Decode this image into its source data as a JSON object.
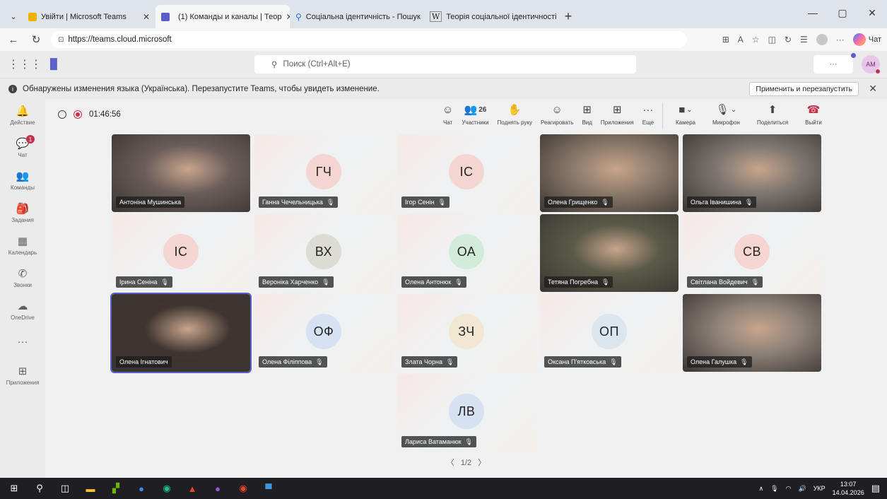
{
  "browser": {
    "tabs": [
      {
        "title": "Увійти | Microsoft Teams",
        "color": "#f0b400"
      },
      {
        "title": "(1) Команды и каналы | Теор",
        "color": "#5b5fc7"
      },
      {
        "title": "Соціальна ідентичність - Пошук",
        "color": "#1e72d8"
      },
      {
        "title": "Теорія соціальної ідентичності —",
        "color": "#444444"
      }
    ],
    "url": "https://teams.cloud.microsoft",
    "chat_label": "Чат"
  },
  "header": {
    "search_placeholder": "Поиск (Ctrl+Alt+E)",
    "more": "···",
    "avatar": "AM"
  },
  "banner": {
    "text": "Обнаружены изменения языка (Українська). Перезапустите Teams, чтобы увидеть изменение.",
    "apply": "Применить и перезапустить"
  },
  "rail": [
    {
      "label": "Действие",
      "icon": "bell-icon",
      "glyph": "🔔"
    },
    {
      "label": "Чат",
      "icon": "chat-icon",
      "glyph": "💬",
      "badge": "1"
    },
    {
      "label": "Команды",
      "icon": "teams-icon",
      "glyph": "👥"
    },
    {
      "label": "Задания",
      "icon": "assignments-icon",
      "glyph": "🎒"
    },
    {
      "label": "Календарь",
      "icon": "calendar-icon",
      "glyph": "▦"
    },
    {
      "label": "Звонки",
      "icon": "phone-icon",
      "glyph": "✆"
    },
    {
      "label": "OneDrive",
      "icon": "onedrive-icon",
      "glyph": "☁"
    },
    {
      "label": "",
      "icon": "more-icon",
      "glyph": "···"
    },
    {
      "label": "Приложения",
      "icon": "apps-icon",
      "glyph": "⊞"
    }
  ],
  "meeting": {
    "timer": "01:46:56",
    "participants_count": "26",
    "tools": [
      {
        "label": "Чат",
        "icon": "chat-icon",
        "glyph": "☺"
      },
      {
        "label": "Участники",
        "icon": "people-icon",
        "glyph": "👥"
      },
      {
        "label": "Поднять руку",
        "icon": "raise-hand-icon",
        "glyph": "✋"
      },
      {
        "label": "Реагировать",
        "icon": "react-icon",
        "glyph": "☺"
      },
      {
        "label": "Вид",
        "icon": "view-icon",
        "glyph": "⊞"
      },
      {
        "label": "Приложения",
        "icon": "apps-icon",
        "glyph": "⊞"
      },
      {
        "label": "Еще",
        "icon": "more-icon",
        "glyph": "···"
      }
    ],
    "media": [
      {
        "label": "Камера",
        "icon": "camera-icon",
        "glyph": "■"
      },
      {
        "label": "Микрофон",
        "icon": "mic-icon",
        "glyph": "🎙"
      },
      {
        "label": "Поделиться",
        "icon": "share-icon",
        "glyph": "⬆"
      },
      {
        "label": "Выйти",
        "icon": "leave-icon",
        "glyph": "☎"
      }
    ],
    "pager": "1/2"
  },
  "participants": [
    {
      "name": "Антоніна Мушинська",
      "type": "video",
      "muted": false,
      "bg": "#6b5e5a"
    },
    {
      "name": "Ганна Чечельницька",
      "initials": "ГЧ",
      "type": "avatar",
      "muted": true,
      "color": "#f5d5d2"
    },
    {
      "name": "Ігор Сенін",
      "initials": "ІС",
      "type": "avatar",
      "muted": true,
      "color": "#f5d5d2"
    },
    {
      "name": "Олена Грищенко",
      "type": "video",
      "muted": true,
      "bg": "#8b7a6a"
    },
    {
      "name": "Ольга Іванишина",
      "type": "video",
      "muted": true,
      "bg": "#7d7670"
    },
    {
      "name": "Ірина Сеніна",
      "initials": "ІС",
      "type": "avatar",
      "muted": true,
      "color": "#f5d5d2"
    },
    {
      "name": "Вероніка Харченко",
      "initials": "ВХ",
      "type": "avatar",
      "muted": true,
      "color": "#dcdcd4"
    },
    {
      "name": "Олена Антонюк",
      "initials": "ОА",
      "type": "avatar",
      "muted": true,
      "color": "#d2ecd9"
    },
    {
      "name": "Тетяна Погребна",
      "type": "video",
      "muted": true,
      "bg": "#5b5a48"
    },
    {
      "name": "Світлана Войдевич",
      "initials": "СВ",
      "type": "avatar",
      "muted": true,
      "color": "#f5d5d2"
    },
    {
      "name": "Олена Ігнатович",
      "type": "video",
      "muted": false,
      "bg": "#3e3430"
    },
    {
      "name": "Олена Філіппова",
      "initials": "ОФ",
      "type": "avatar",
      "muted": true,
      "color": "#d6e2f2"
    },
    {
      "name": "Злата Чорна",
      "initials": "ЗЧ",
      "type": "avatar",
      "muted": true,
      "color": "#f2e7d2"
    },
    {
      "name": "Оксана П'ятковська",
      "initials": "ОП",
      "type": "avatar",
      "muted": true,
      "color": "#dce6ee"
    },
    {
      "name": "Олена Галушка",
      "type": "video",
      "muted": true,
      "bg": "#8d8178"
    },
    {
      "name": "Лариса Ватаманюк",
      "initials": "ЛВ",
      "type": "avatar",
      "muted": true,
      "color": "#d6e2f2"
    }
  ],
  "taskbar": {
    "lang": "УКР",
    "time": "13:07",
    "date": "14.04.2026"
  }
}
